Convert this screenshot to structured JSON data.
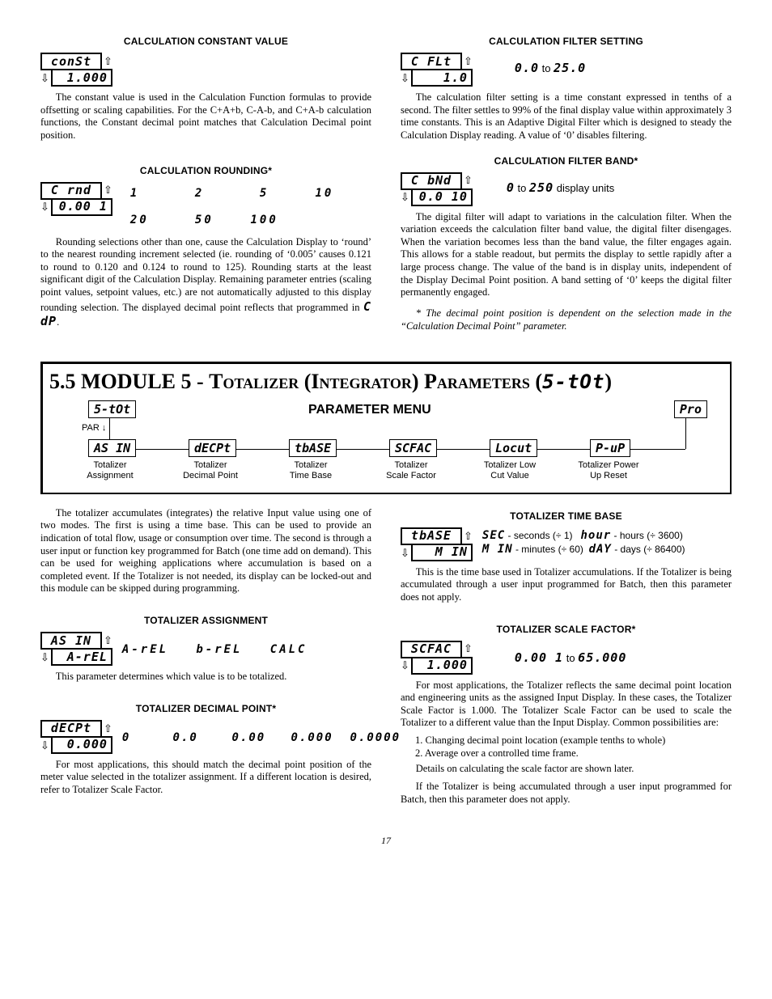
{
  "left_top": {
    "h_const": "CALCULATION CONSTANT VALUE",
    "lcd_const_top": "conSt",
    "lcd_const_bot": "1.000",
    "p_const": "The constant value is used in the Calculation Function formulas to provide offsetting or scaling capabilities. For the C+A+b, C-A-b, and C+A-b calculation functions, the Constant decimal point matches that Calculation Decimal point position.",
    "h_round": "CALCULATION ROUNDING*",
    "lcd_round_top": "C  rnd",
    "lcd_round_bot": "0.00 1",
    "round_row1": "1      2      5     10",
    "round_row2": "20     50    100",
    "p_round": "Rounding selections other than one, cause the Calculation Display to ‘round’ to the nearest rounding increment selected (ie. rounding of ‘0.005’ causes 0.121 to round to 0.120 and 0.124 to round to 125). Rounding starts at the least significant digit of the Calculation Display. Remaining parameter entries (scaling point values, setpoint values, etc.) are not automatically adjusted to this display rounding selection. The displayed decimal point reflects that programmed in ",
    "p_round_seg": "C  dP"
  },
  "right_top": {
    "h_filt": "CALCULATION FILTER SETTING",
    "lcd_filt_top": "C  FLt",
    "lcd_filt_bot": "1.0",
    "filt_range_a": "0.0",
    "filt_range_mid": " to ",
    "filt_range_b": "25.0",
    "p_filt": "The calculation filter setting is a time constant expressed in tenths of a second. The filter settles to 99% of the final display value within approximately 3 time constants. This is an Adaptive Digital Filter which is designed to steady the Calculation Display reading. A value of ‘0’ disables filtering.",
    "h_band": "CALCULATION FILTER BAND*",
    "lcd_band_top": "C  bNd",
    "lcd_band_bot": "0.0 10",
    "band_range_a": "0",
    "band_range_mid": " to ",
    "band_range_b": "250",
    "band_range_suffix": " display units",
    "p_band": "The digital filter will adapt to variations in the calculation filter. When the variation exceeds the calculation filter band value, the digital filter disengages. When the variation becomes less than the band value, the filter engages again. This allows for a stable readout, but permits the display to settle rapidly after a large process change. The value of the band is in display units, independent of the Display Decimal Point position. A band setting of ‘0’ keeps the digital filter permanently engaged.",
    "note": "* The decimal point position is dependent on the selection made in the “Calculation Decimal Point” parameter."
  },
  "module": {
    "title_prefix": "5.5  MODULE 5 - ",
    "title_main": "Totalizer (Integrator) Parameters (",
    "title_seg": "5-tOt",
    "title_suffix": ")",
    "menu_label": "PARAMETER MENU",
    "par": "PAR",
    "pro": "Pro",
    "box1": "5-tOt",
    "nodes": [
      {
        "code": "AS IN",
        "label": "Totalizer\nAssignment"
      },
      {
        "code": "dECPt",
        "label": "Totalizer\nDecimal Point"
      },
      {
        "code": "tbASE",
        "label": "Totalizer\nTime Base"
      },
      {
        "code": "SCFAC",
        "label": "Totalizer\nScale Factor"
      },
      {
        "code": "Locut",
        "label": "Totalizer Low\nCut Value"
      },
      {
        "code": "P-uP",
        "label": "Totalizer Power\nUp Reset"
      }
    ]
  },
  "lower_left": {
    "p_intro": "The totalizer accumulates (integrates) the relative Input value using one of two modes. The first is using a time base. This can be used to provide an indication of total flow, usage or consumption over time. The second is through a user input or function key programmed for Batch (one time add on demand). This can be used for weighing applications where accumulation is based on a completed event. If the Totalizer is not needed, its display can be locked-out and this module can be skipped during programming.",
    "h_assign": "TOTALIZER ASSIGNMENT",
    "lcd_assign_top": "AS IN",
    "lcd_assign_bot": "A-rEL",
    "assign_opts": "A-rEL   b-rEL   CALC",
    "p_assign": "This parameter determines which value is to be totalized.",
    "h_decpt": "TOTALIZER DECIMAL POINT*",
    "lcd_decpt_top": "dECPt",
    "lcd_decpt_bot": "0.000",
    "decpt_opts": "0     0.0    0.00   0.000  0.0000",
    "p_decpt": "For most applications, this should match the decimal point position of the meter value selected in the totalizer assignment. If a different location is desired, refer to Totalizer Scale Factor."
  },
  "lower_right": {
    "h_tbase": "TOTALIZER TIME BASE",
    "lcd_tbase_top": "tbASE",
    "lcd_tbase_bot": "M IN",
    "tb_sec_code": "SEC",
    "tb_sec_txt": " - seconds (÷ 1)",
    "tb_hour_code": "hour",
    "tb_hour_txt": " - hours (÷ 3600)",
    "tb_min_code": "M IN",
    "tb_min_txt": " - minutes (÷ 60)",
    "tb_day_code": "dAY",
    "tb_day_txt": " - days (÷ 86400)",
    "p_tbase": "This is the time base used in Totalizer accumulations. If the Totalizer is being accumulated through a user input programmed for Batch, then this parameter does not apply.",
    "h_scfac": "TOTALIZER SCALE FACTOR*",
    "lcd_scfac_top": "SCFAC",
    "lcd_scfac_bot": "1.000",
    "scfac_range_a": "0.00 1",
    "scfac_range_mid": " to ",
    "scfac_range_b": "65.000",
    "p_scfac": "For most applications, the Totalizer reflects the same decimal point location and engineering units as the assigned Input Display. In these cases, the Totalizer Scale Factor is 1.000. The Totalizer Scale Factor can be used to scale the Totalizer to a different value than the Input Display. Common possibilities are:",
    "li1": "1. Changing decimal point location (example tenths to whole)",
    "li2": "2. Average over a controlled time frame.",
    "p_scfac2": "Details on calculating the scale factor are shown later.",
    "p_scfac3": "If the Totalizer is being accumulated through a user input programmed for Batch, then this parameter does not apply."
  },
  "page": "17"
}
